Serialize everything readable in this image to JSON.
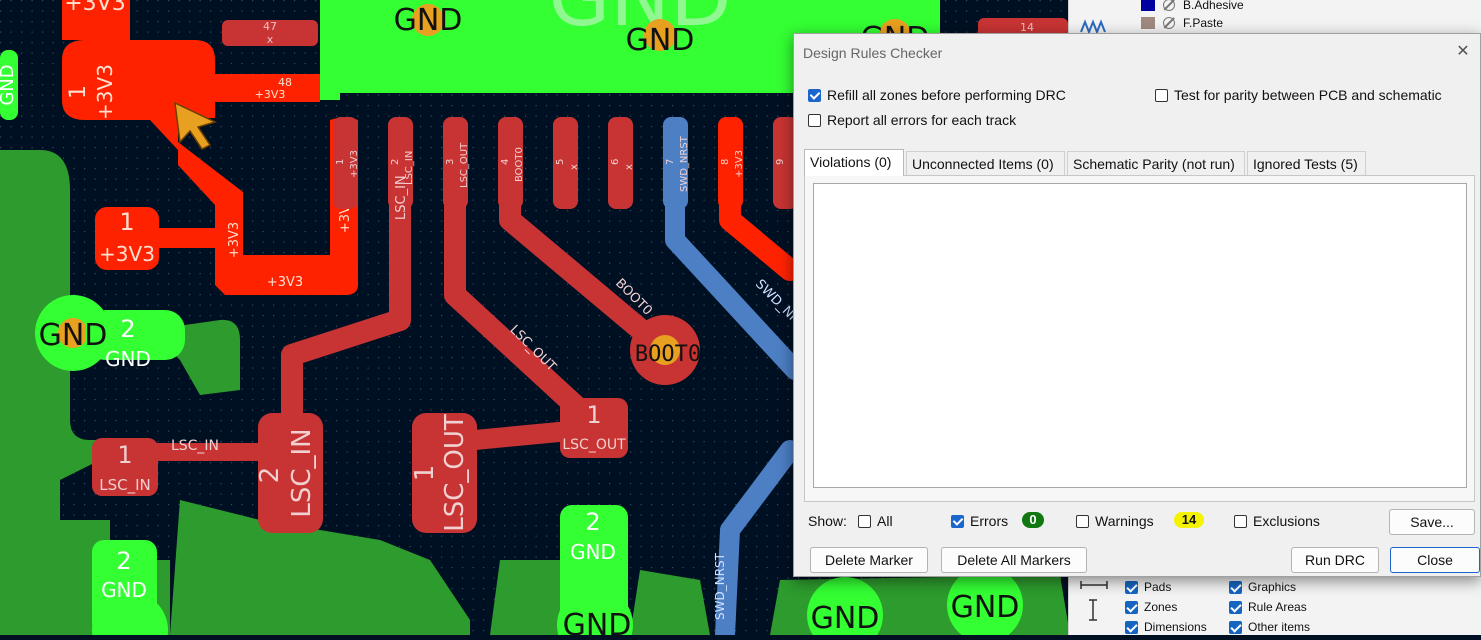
{
  "pcb": {
    "net_gnd": "GND",
    "net_3v3": "+3V3",
    "net_lsc_in": "LSC_IN",
    "net_lsc_out": "LSC_OUT",
    "net_boot0": "BOOT0",
    "net_swd_nrst": "SWD_NRST",
    "pad_1": "1",
    "pad_2": "2",
    "pad_3": "3",
    "pad_4": "4",
    "pad_5": "5",
    "pad_6": "6",
    "pad_7": "7",
    "pad_8": "8",
    "pad_9": "9",
    "pad_14": "14",
    "pad_47": "47",
    "pad_48": "48",
    "no_connect": "x",
    "big_gnd": "GND"
  },
  "layers": [
    {
      "name": "B.Adhesive",
      "color": "#0000a0"
    },
    {
      "name": "F.Paste",
      "color": "#a08a80"
    }
  ],
  "objects": [
    {
      "label": "Pads"
    },
    {
      "label": "Graphics"
    },
    {
      "label": "Zones"
    },
    {
      "label": "Rule Areas"
    },
    {
      "label": "Dimensions"
    },
    {
      "label": "Other items"
    }
  ],
  "dialog": {
    "title": "Design Rules Checker",
    "close_glyph": "✕",
    "options": {
      "refill_zones": "Refill all zones before performing DRC",
      "report_all_errors": "Report all errors for each track",
      "test_parity": "Test for parity between PCB and schematic"
    },
    "tabs": [
      {
        "label": "Violations (0)"
      },
      {
        "label": "Unconnected Items (0)"
      },
      {
        "label": "Schematic Parity (not run)"
      },
      {
        "label": "Ignored Tests (5)"
      }
    ],
    "show_label": "Show:",
    "filters": {
      "all": "All",
      "errors": "Errors",
      "errors_count": "0",
      "warnings": "Warnings",
      "warnings_count": "14",
      "exclusions": "Exclusions"
    },
    "buttons": {
      "save": "Save...",
      "delete_marker": "Delete Marker",
      "delete_all": "Delete All Markers",
      "run_drc": "Run DRC",
      "close": "Close"
    }
  },
  "colors": {
    "board_bg": "#001023",
    "copper_front": "#c83434",
    "copper_back": "#4d7fc4",
    "ground_fill": "#2d9b2d",
    "pad_green": "#33ff33",
    "accent": "#1a66cc",
    "badge_errors": "#117711",
    "badge_warnings": "#f4f400"
  }
}
